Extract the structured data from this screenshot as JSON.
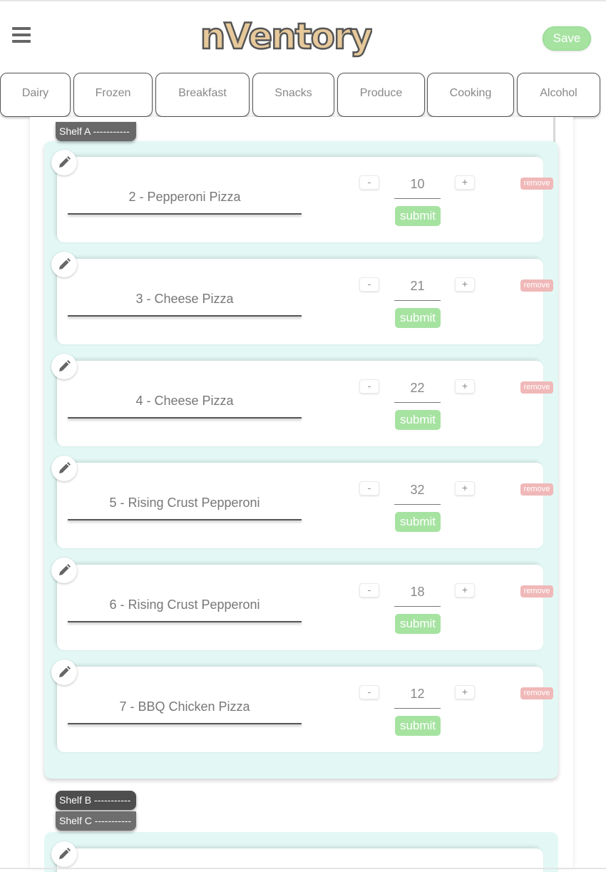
{
  "header": {
    "logo_text": "nVentory",
    "save_label": "Save"
  },
  "tabs": [
    {
      "label": "Dairy"
    },
    {
      "label": "Frozen"
    },
    {
      "label": "Breakfast"
    },
    {
      "label": "Snacks"
    },
    {
      "label": "Produce"
    },
    {
      "label": "Cooking"
    },
    {
      "label": "Alcohol"
    }
  ],
  "shelves": [
    {
      "label": "Shelf A -----------"
    },
    {
      "label": "Shelf B -----------"
    },
    {
      "label": "Shelf C -----------"
    }
  ],
  "items": [
    {
      "name": "2 - Pepperoni Pizza",
      "quantity": "10"
    },
    {
      "name": "3 - Cheese Pizza",
      "quantity": "21"
    },
    {
      "name": "4 - Cheese Pizza",
      "quantity": "22"
    },
    {
      "name": "5 - Rising Crust Pepperoni",
      "quantity": "32"
    },
    {
      "name": "6 - Rising Crust Pepperoni",
      "quantity": "18"
    },
    {
      "name": "7 - BBQ Chicken Pizza",
      "quantity": "12"
    }
  ],
  "item_controls": {
    "minus": "-",
    "plus": "+",
    "submit": "submit",
    "remove": "remove"
  },
  "icons": {
    "menu": "hamburger-menu-icon",
    "edit": "pencil-icon"
  },
  "colors": {
    "logo_fill": "#e6c89a",
    "logo_outline": "#555555",
    "submit_green": "#a6e3a1",
    "remove_red": "#f0b8b8",
    "shelf_panel": "#e3f8f5"
  }
}
